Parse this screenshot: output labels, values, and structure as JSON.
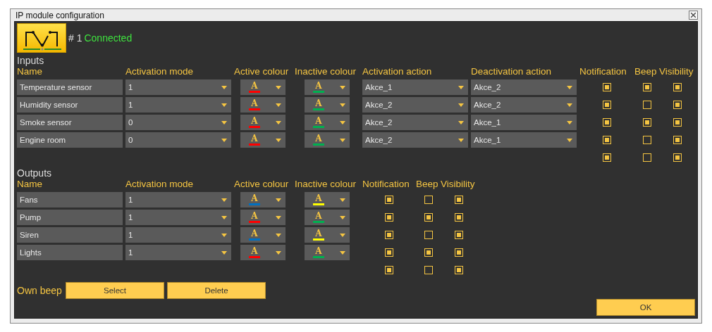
{
  "window": {
    "title": "IP module configuration"
  },
  "device": {
    "number": "# 1",
    "status": "Connected"
  },
  "inputs": {
    "title": "Inputs",
    "columns": [
      "Name",
      "Activation mode",
      "Active colour",
      "Inactive colour",
      "Activation action",
      "Deactivation action",
      "Notification",
      "Beep",
      "Visibility"
    ],
    "rows": [
      {
        "name": "Temperature sensor",
        "activation_mode": "1",
        "active_colour": {
          "glyph": "A",
          "color": "#ff0000"
        },
        "inactive_colour": {
          "glyph": "A",
          "color": "#00b050"
        },
        "activation_action": "Akce_1",
        "deactivation_action": "Akce_2",
        "notification": true,
        "beep": true,
        "visibility": true
      },
      {
        "name": "Humidity sensor",
        "activation_mode": "1",
        "active_colour": {
          "glyph": "A",
          "color": "#ff0000"
        },
        "inactive_colour": {
          "glyph": "A",
          "color": "#00b050"
        },
        "activation_action": "Akce_2",
        "deactivation_action": "Akce_2",
        "notification": true,
        "beep": false,
        "visibility": true
      },
      {
        "name": "Smoke sensor",
        "activation_mode": "0",
        "active_colour": {
          "glyph": "A",
          "color": "#ff0000"
        },
        "inactive_colour": {
          "glyph": "A",
          "color": "#00b050"
        },
        "activation_action": "Akce_2",
        "deactivation_action": "Akce_1",
        "notification": true,
        "beep": true,
        "visibility": true
      },
      {
        "name": "Engine room",
        "activation_mode": "0",
        "active_colour": {
          "glyph": "A",
          "color": "#ff0000"
        },
        "inactive_colour": {
          "glyph": "A",
          "color": "#00b050"
        },
        "activation_action": "Akce_2",
        "deactivation_action": "Akce_1",
        "notification": true,
        "beep": false,
        "visibility": true
      }
    ],
    "all": {
      "notification": true,
      "beep": false,
      "visibility": true
    }
  },
  "outputs": {
    "title": "Outputs",
    "columns": [
      "Name",
      "Activation mode",
      "Active colour",
      "Inactive colour",
      "Notification",
      "Beep",
      "Visibility"
    ],
    "rows": [
      {
        "name": "Fans",
        "activation_mode": "1",
        "active_colour": {
          "glyph": "A",
          "color": "#0070c0"
        },
        "inactive_colour": {
          "glyph": "A",
          "color": "#ffff00"
        },
        "notification": true,
        "beep": false,
        "visibility": true
      },
      {
        "name": "Pump",
        "activation_mode": "1",
        "active_colour": {
          "glyph": "A",
          "color": "#ff0000"
        },
        "inactive_colour": {
          "glyph": "A",
          "color": "#00b050"
        },
        "notification": true,
        "beep": true,
        "visibility": true
      },
      {
        "name": "Siren",
        "activation_mode": "1",
        "active_colour": {
          "glyph": "A",
          "color": "#0070c0"
        },
        "inactive_colour": {
          "glyph": "A",
          "color": "#ffff00"
        },
        "notification": true,
        "beep": false,
        "visibility": true
      },
      {
        "name": "Lights",
        "activation_mode": "1",
        "active_colour": {
          "glyph": "A",
          "color": "#ff0000"
        },
        "inactive_colour": {
          "glyph": "A",
          "color": "#00b050"
        },
        "notification": true,
        "beep": true,
        "visibility": true
      }
    ],
    "all": {
      "notification": true,
      "beep": false,
      "visibility": true
    }
  },
  "own_beep": {
    "label": "Own beep",
    "buttons": [
      "Select",
      "Delete"
    ]
  },
  "ok_button": "OK"
}
